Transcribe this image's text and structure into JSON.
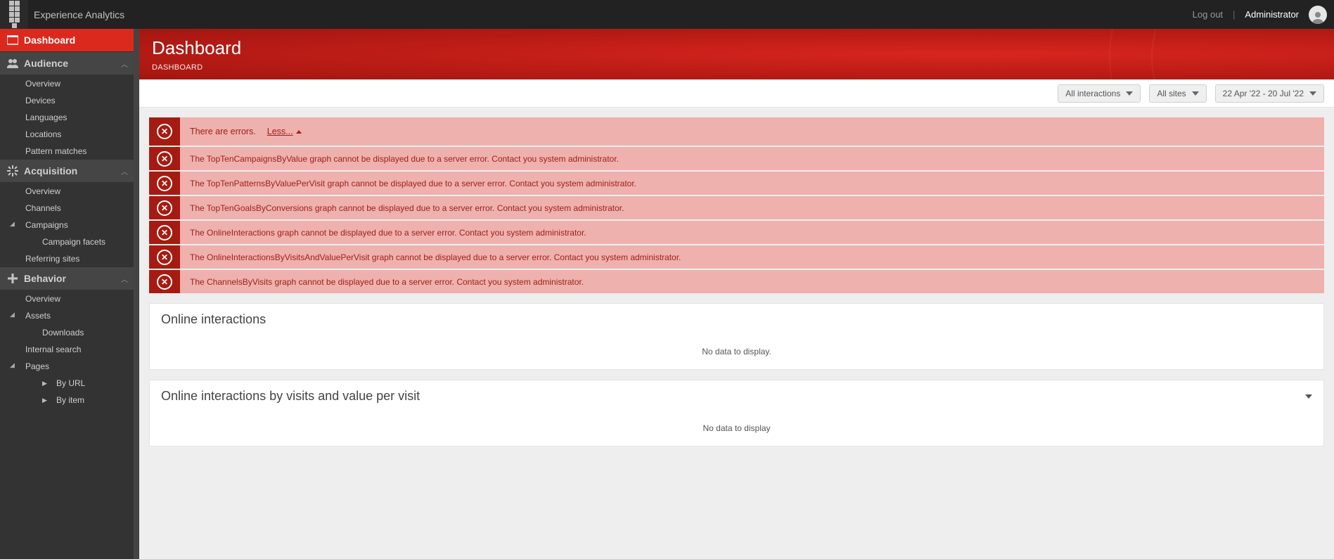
{
  "header": {
    "app_title": "Experience Analytics",
    "logout_label": "Log out",
    "user_name": "Administrator"
  },
  "page": {
    "title": "Dashboard",
    "breadcrumb": "DASHBOARD"
  },
  "filters": {
    "interactions": "All interactions",
    "sites": "All sites",
    "date_range": "22 Apr '22 - 20 Jul '22"
  },
  "sidebar": {
    "dashboard": "Dashboard",
    "audience": {
      "label": "Audience",
      "items": [
        "Overview",
        "Devices",
        "Languages",
        "Locations",
        "Pattern matches"
      ]
    },
    "acquisition": {
      "label": "Acquisition",
      "overview": "Overview",
      "channels": "Channels",
      "campaigns": "Campaigns",
      "campaign_facets": "Campaign facets",
      "referring_sites": "Referring sites"
    },
    "behavior": {
      "label": "Behavior",
      "overview": "Overview",
      "assets": "Assets",
      "downloads": "Downloads",
      "internal_search": "Internal search",
      "pages": "Pages",
      "by_url": "By URL",
      "by_item": "By item"
    }
  },
  "errors": {
    "summary_text": "There are errors.",
    "toggle_label": "Less...",
    "items": [
      "The TopTenCampaignsByValue graph cannot be displayed due to a server error. Contact you system administrator.",
      "The TopTenPatternsByValuePerVisit graph cannot be displayed due to a server error. Contact you system administrator.",
      "The TopTenGoalsByConversions graph cannot be displayed due to a server error. Contact you system administrator.",
      "The OnlineInteractions graph cannot be displayed due to a server error. Contact you system administrator.",
      "The OnlineInteractionsByVisitsAndValuePerVisit graph cannot be displayed due to a server error. Contact you system administrator.",
      "The ChannelsByVisits graph cannot be displayed due to a server error. Contact you system administrator."
    ]
  },
  "panels": {
    "online_interactions": {
      "title": "Online interactions",
      "empty_text": "No data to display."
    },
    "online_interactions_by_visit": {
      "title": "Online interactions by visits and value per visit",
      "empty_text": "No data to display"
    }
  }
}
